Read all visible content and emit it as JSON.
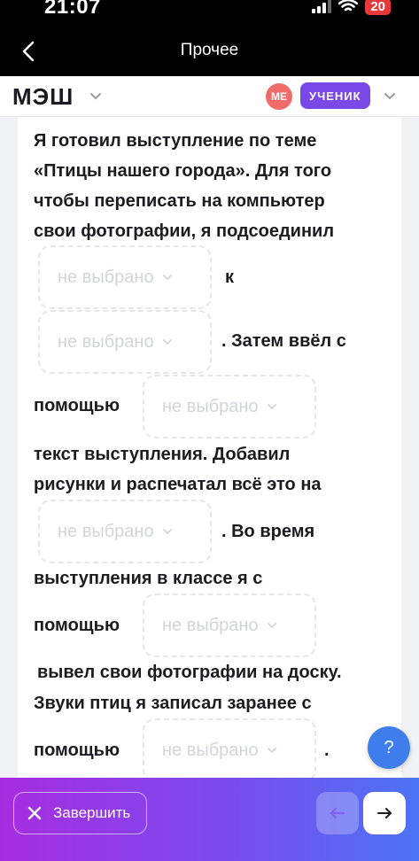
{
  "status_bar": {
    "time": "21:07",
    "battery": "20"
  },
  "app_bar": {
    "title": "Прочее"
  },
  "header": {
    "logo": "МЭШ",
    "avatar_initials": "МЕ",
    "role": "УЧЕНИК"
  },
  "question": {
    "lines": [
      "Я готовил выступление по теме",
      "«Птицы нашего города». Для того",
      "чтобы переписать на компьютер",
      "свои фотографии, я подсоединил",
      "к",
      ". Затем ввёл с",
      "помощью",
      "текст выступления. Добавил",
      "рисунки и распечатал всё это на",
      ". Во время",
      "выступления в классе я с",
      "помощью",
      "вывел свои фотографии на доску.",
      "Звуки птиц я записал заранее с",
      "помощью",
      "."
    ],
    "dropdown_placeholder": "не выбрано"
  },
  "help_label": "?",
  "footer": {
    "finish_label": "Завершить"
  },
  "colors": {
    "accent": "#7a48e6",
    "help": "#3f7dec",
    "avatar": "#f26b6b"
  }
}
